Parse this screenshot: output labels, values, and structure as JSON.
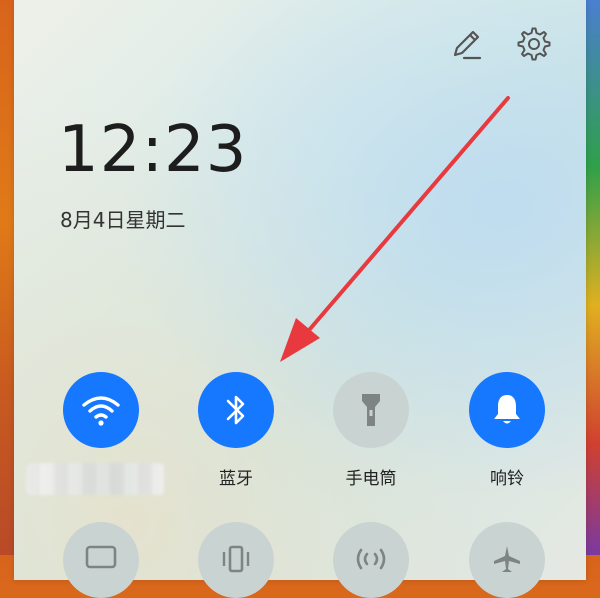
{
  "status": {
    "time": "12:23",
    "date": "8月4日星期二"
  },
  "header_icons": [
    "pencil-icon",
    "gear-icon"
  ],
  "toggles": [
    {
      "id": "wifi",
      "label": "",
      "icon": "wifi-icon",
      "state": "on"
    },
    {
      "id": "bluetooth",
      "label": "蓝牙",
      "icon": "bluetooth-icon",
      "state": "on"
    },
    {
      "id": "flashlight",
      "label": "手电筒",
      "icon": "flashlight-icon",
      "state": "off"
    },
    {
      "id": "ring",
      "label": "响铃",
      "icon": "bell-icon",
      "state": "on"
    }
  ],
  "second_row_icons": [
    "screencast-icon",
    "vibrate-icon",
    "nfc-icon",
    "airplane-icon"
  ],
  "colors": {
    "accent_on": "#1677ff",
    "tile_off": "#c9d4d2",
    "annotation_arrow": "#e8393f"
  }
}
